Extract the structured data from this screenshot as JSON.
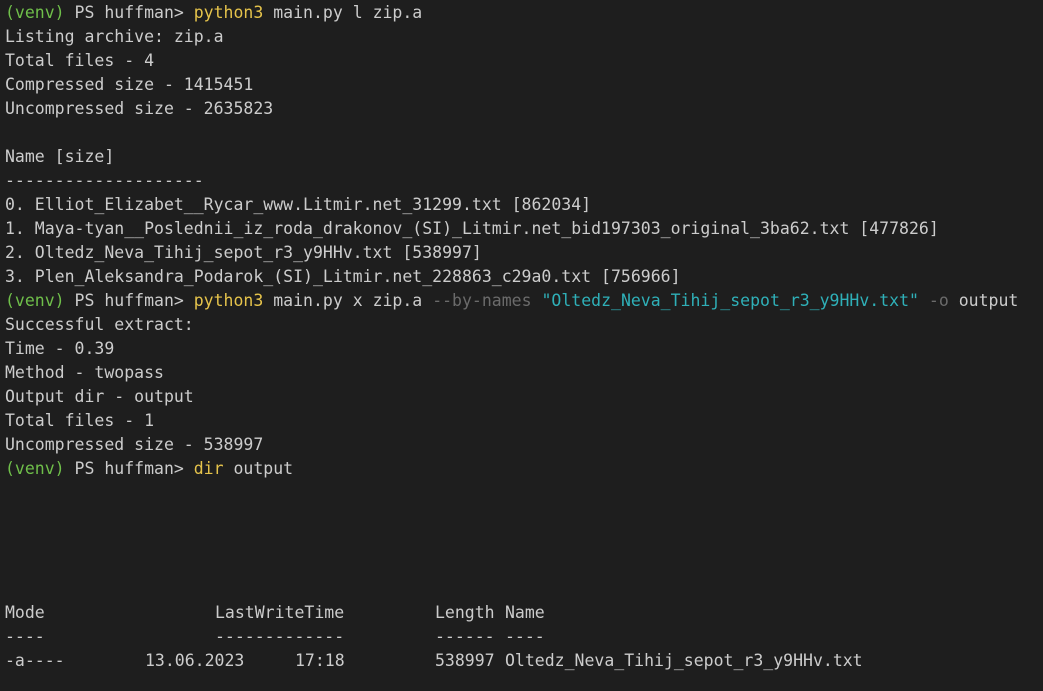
{
  "prompt": {
    "venv": "(venv)",
    "ps": " PS huffman> "
  },
  "cmd1": {
    "program": "python3",
    "args": " main.py l zip.a"
  },
  "listing": {
    "header": "Listing archive: zip.a",
    "total_files": "Total files - 4",
    "compressed": "Compressed size - 1415451",
    "uncompressed": "Uncompressed size - 2635823",
    "blank": " ",
    "col_header": "Name [size]",
    "separator": "--------------------",
    "files": [
      "0. Elliot_Elizabet__Rycar_www.Litmir.net_31299.txt [862034]",
      "1. Maya-tyan__Poslednii_iz_roda_drakonov_(SI)_Litmir.net_bid197303_original_3ba62.txt [477826]",
      "2. Oltedz_Neva_Tihij_sepot_r3_y9HHv.txt [538997]",
      "3. Plen_Aleksandra_Podarok_(SI)_Litmir.net_228863_c29a0.txt [756966]"
    ]
  },
  "cmd2": {
    "program": "python3",
    "args": " main.py x zip.a ",
    "flag1": "--by-names",
    "space1": " ",
    "string": "\"Oltedz_Neva_Tihij_sepot_r3_y9HHv.txt\"",
    "space2": " ",
    "flag2": "-o",
    "rest": " output"
  },
  "extract": {
    "success": "Successful extract:",
    "time": "Time - 0.39",
    "method": "Method - twopass",
    "output_dir": "Output dir - output",
    "total_files": "Total files - 1",
    "uncompressed": "Uncompressed size - 538997"
  },
  "cmd3": {
    "program": "dir",
    "args": " output"
  },
  "dir_table": {
    "headers": {
      "mode": "Mode",
      "last_write_time": "LastWriteTime",
      "length": "Length",
      "name": "Name"
    },
    "separators": {
      "mode": "----",
      "last_write_time": "-------------",
      "length": "------",
      "name": "----"
    },
    "rows": [
      {
        "mode": "-a----",
        "date": "13.06.2023",
        "time": "17:18",
        "length": "538997",
        "name": "Oltedz_Neva_Tihij_sepot_r3_y9HHv.txt"
      }
    ]
  },
  "colors": {
    "background": "#1e1e1e",
    "text": "#cccccc",
    "venv": "#6fbf4a",
    "command": "#e5c34b",
    "flag": "#6b6b6b",
    "string": "#2fb0b8"
  }
}
